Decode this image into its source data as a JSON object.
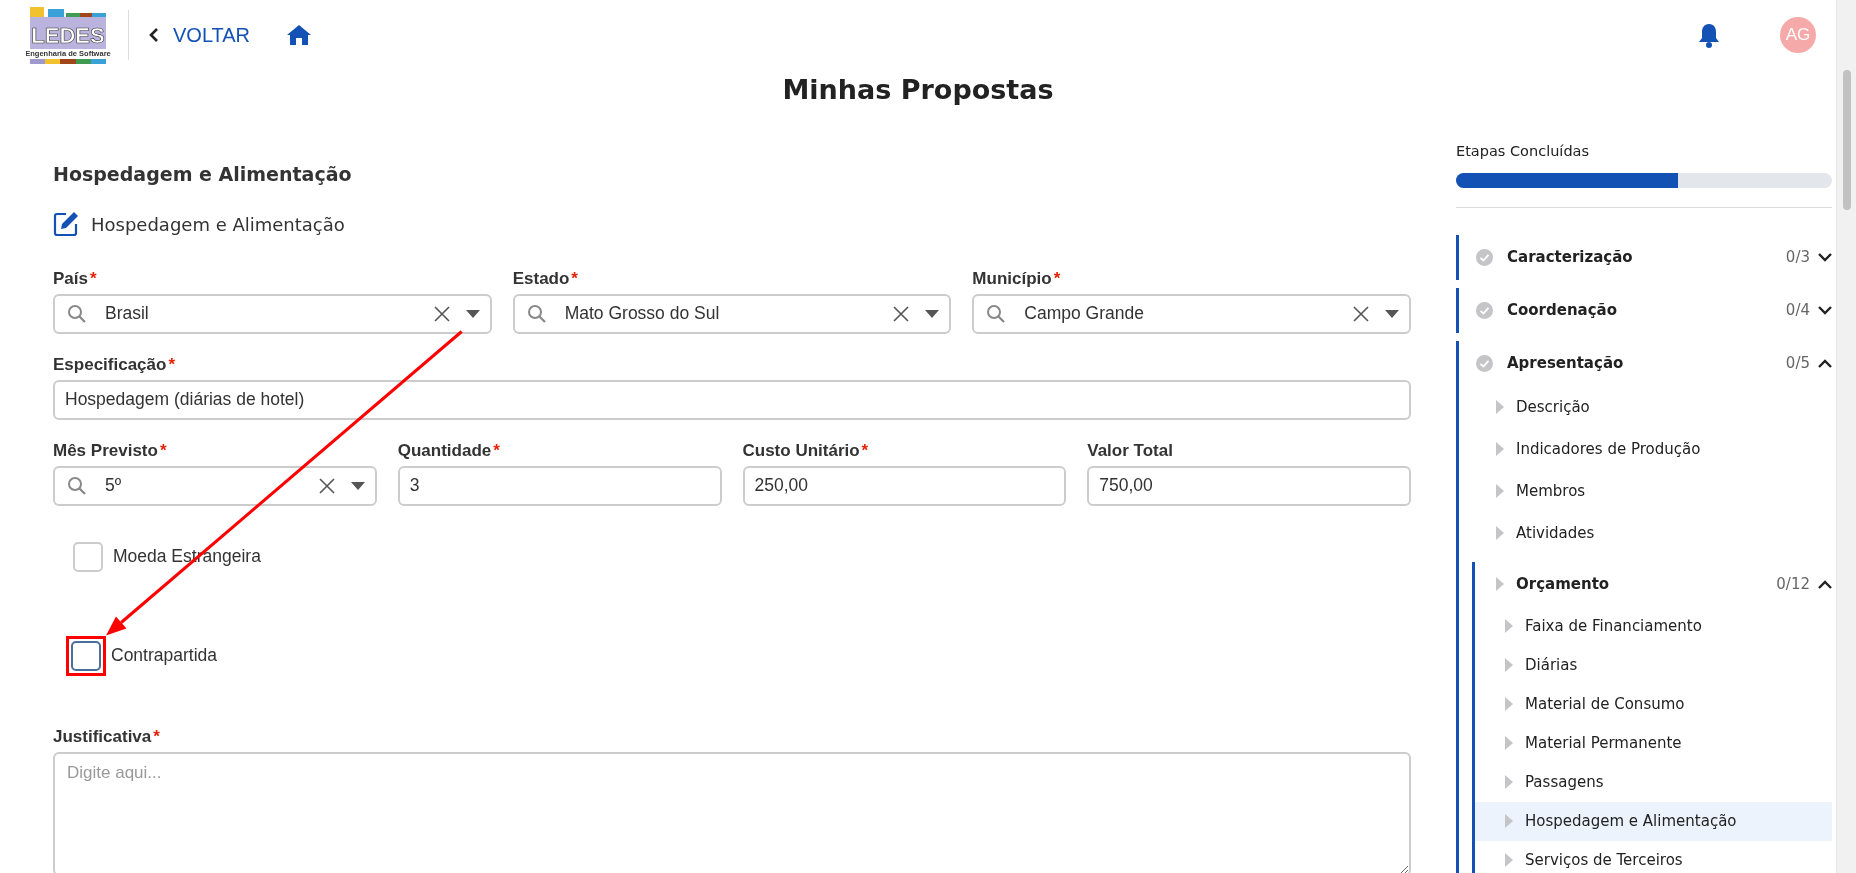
{
  "header": {
    "logo_text": "LEDES",
    "logo_tagline": "Engenharia de Software",
    "back_label": "VOLTAR",
    "avatar_initials": "AG"
  },
  "page_title": "Minhas Propostas",
  "form": {
    "section_title": "Hospedagem e Alimentação",
    "subtitle": "Hospedagem e Alimentação",
    "required_mark": "*",
    "field_groups": [
      {
        "fields": [
          {
            "label": "País",
            "required": true,
            "kind": "select",
            "value": "Brasil"
          },
          {
            "label": "Estado",
            "required": true,
            "kind": "select",
            "value": "Mato Grosso do Sul"
          },
          {
            "label": "Município",
            "required": true,
            "kind": "select",
            "value": "Campo Grande"
          }
        ]
      },
      {
        "fields": [
          {
            "label": "Especificação",
            "required": true,
            "kind": "text",
            "value": "Hospedagem (diárias de hotel)"
          }
        ]
      },
      {
        "fields": [
          {
            "label": "Mês Previsto",
            "required": true,
            "kind": "select",
            "value": "5º"
          },
          {
            "label": "Quantidade",
            "required": true,
            "kind": "text",
            "value": "3"
          },
          {
            "label": "Custo Unitário",
            "required": true,
            "kind": "text",
            "value": "250,00"
          },
          {
            "label": "Valor Total",
            "required": false,
            "kind": "text",
            "value": "750,00"
          }
        ]
      }
    ],
    "checkboxes": [
      {
        "label": "Moeda Estrangeira",
        "checked": false,
        "highlighted": false
      },
      {
        "label": "Contrapartida",
        "checked": false,
        "highlighted": true
      }
    ],
    "justification": {
      "label": "Justificativa",
      "required": true,
      "placeholder": "Digite aqui..."
    }
  },
  "sidebar": {
    "progress_title": "Etapas Concluídas",
    "level": 0.59,
    "steps": [
      {
        "title": "Caracterização",
        "count": "0/3",
        "expanded": false
      },
      {
        "title": "Coordenação",
        "count": "0/4",
        "expanded": false
      },
      {
        "title": "Apresentação",
        "count": "0/5",
        "expanded": true,
        "children": [
          {
            "title": "Descrição",
            "selected": false
          },
          {
            "title": "Indicadores de Produção",
            "selected": false
          },
          {
            "title": "Membros",
            "selected": false
          },
          {
            "title": "Atividades",
            "selected": false
          },
          {
            "title": "Orçamento",
            "count": "0/12",
            "expanded": true,
            "selected": false,
            "children": [
              {
                "title": "Faixa de Financiamento",
                "selected": false
              },
              {
                "title": "Diárias",
                "selected": false
              },
              {
                "title": "Material de Consumo",
                "selected": false
              },
              {
                "title": "Material Permanente",
                "selected": false
              },
              {
                "title": "Passagens",
                "selected": false
              },
              {
                "title": "Hospedagem e Alimentação",
                "selected": true
              },
              {
                "title": "Serviços de Terceiros",
                "selected": false
              }
            ]
          }
        ]
      }
    ]
  }
}
